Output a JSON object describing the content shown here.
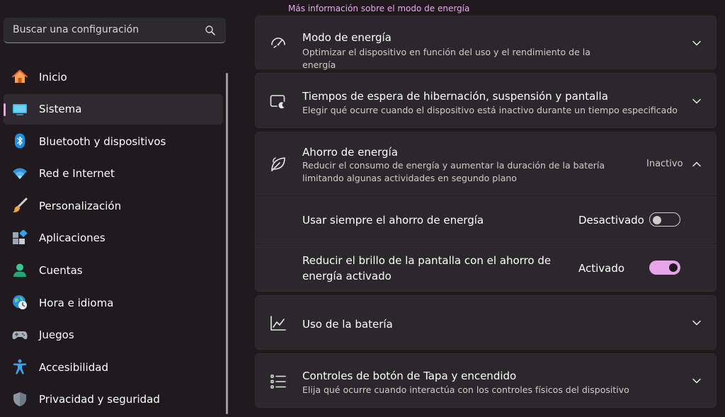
{
  "search": {
    "placeholder": "Buscar una configuración"
  },
  "sidebar": {
    "items": [
      {
        "label": "Inicio",
        "icon": "home-icon"
      },
      {
        "label": "Sistema",
        "icon": "system-icon",
        "selected": true
      },
      {
        "label": "Bluetooth y dispositivos",
        "icon": "bluetooth-icon"
      },
      {
        "label": "Red e Internet",
        "icon": "wifi-icon"
      },
      {
        "label": "Personalización",
        "icon": "brush-icon"
      },
      {
        "label": "Aplicaciones",
        "icon": "apps-icon"
      },
      {
        "label": "Cuentas",
        "icon": "account-icon"
      },
      {
        "label": "Hora e idioma",
        "icon": "globe-clock-icon"
      },
      {
        "label": "Juegos",
        "icon": "gamepad-icon"
      },
      {
        "label": "Accesibilidad",
        "icon": "accessibility-icon"
      },
      {
        "label": "Privacidad y seguridad",
        "icon": "shield-icon"
      }
    ]
  },
  "main": {
    "power_link": "Más información sobre el modo de energía",
    "power_mode": {
      "title": "Modo de energía",
      "subtitle": "Optimizar el dispositivo en función del uso y el rendimiento de la energía"
    },
    "sleep": {
      "title": "Tiempos de espera de hibernación, suspensión y pantalla",
      "subtitle": "Elegir qué ocurre cuando el dispositivo está inactivo durante un tiempo especificado"
    },
    "saver": {
      "title": "Ahorro de energía",
      "subtitle_line1": "Reducir el consumo de energía y aumentar la duración de la batería",
      "subtitle_line2": "limitando algunas actividades en segundo plano",
      "status": "Inactivo",
      "always": {
        "label": "Usar siempre el ahorro de energía",
        "state_label": "Desactivado",
        "on": false
      },
      "brightness": {
        "label_line1": "Reducir el brillo de la pantalla con el ahorro de",
        "label_line2": "energía activado",
        "state_label": "Activado",
        "on": true
      }
    },
    "battery": {
      "title": "Uso de la batería"
    },
    "lid": {
      "title": "Controles de botón de Tapa y encendido",
      "subtitle": "Elija qué ocurre cuando interactúa con los controles físicos del dispositivo"
    }
  },
  "colors": {
    "accent": "#e7a5ea",
    "background": "#201a1f",
    "card": "#2c272c"
  }
}
